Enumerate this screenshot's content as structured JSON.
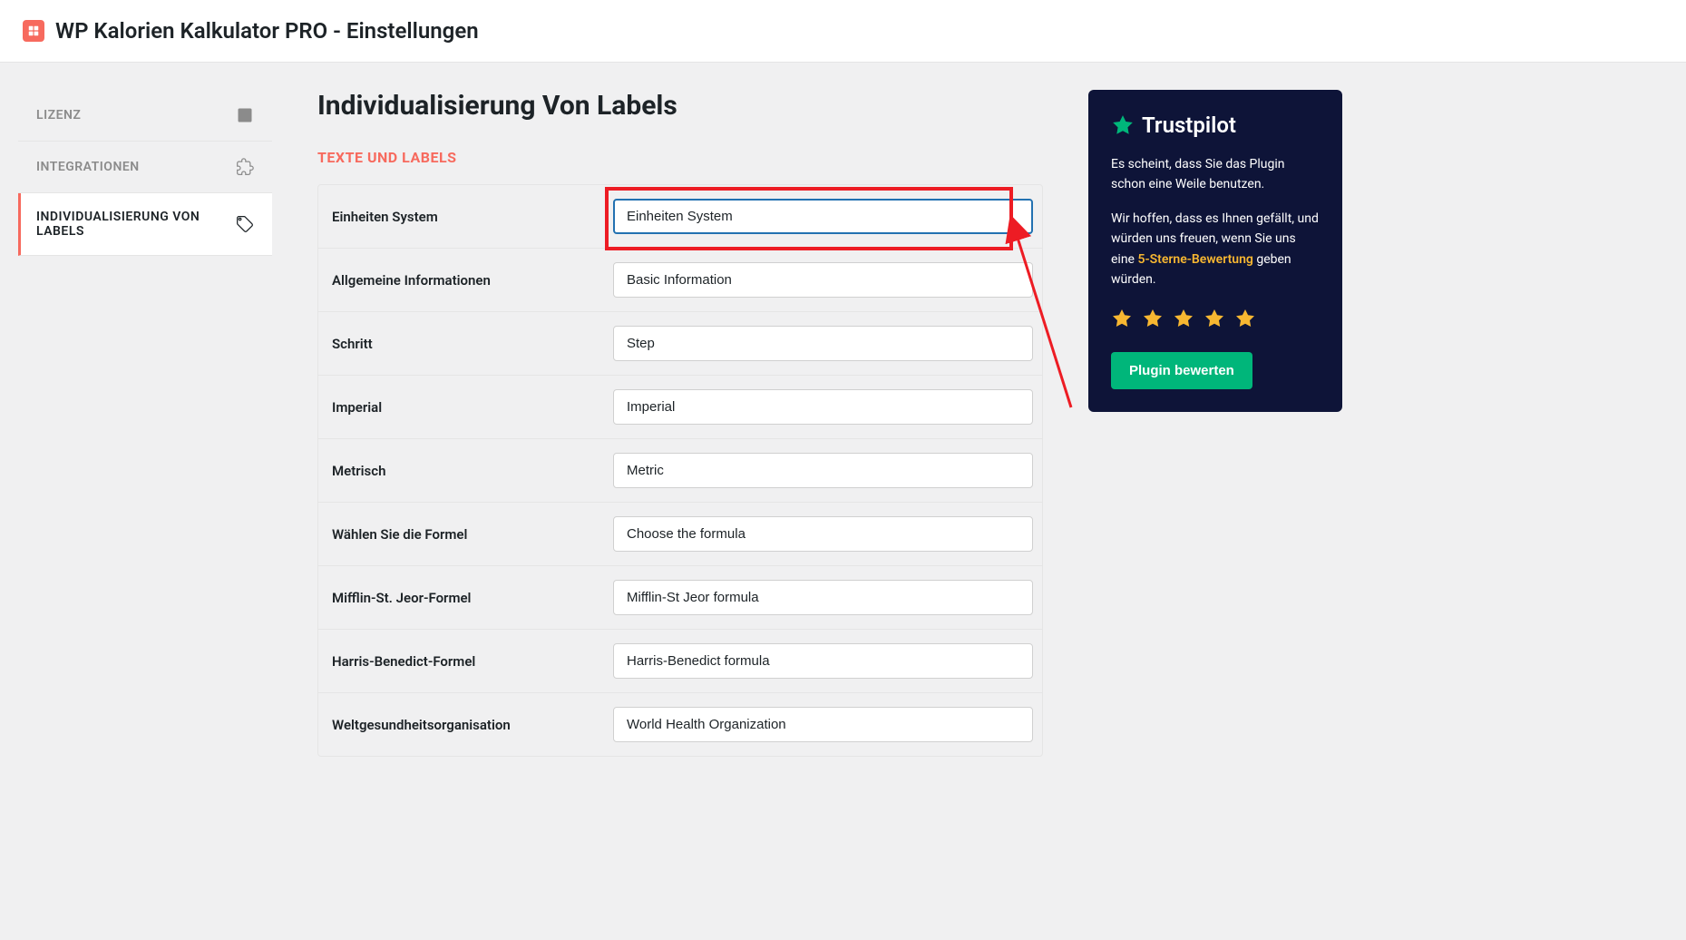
{
  "header": {
    "title": "WP Kalorien Kalkulator PRO - Einstellungen"
  },
  "sidebar": {
    "items": [
      {
        "label": "LIZENZ",
        "active": false,
        "icon": "license"
      },
      {
        "label": "INTEGRATIONEN",
        "active": false,
        "icon": "puzzle"
      },
      {
        "label": "INDIVIDUALISIERUNG VON LABELS",
        "active": true,
        "icon": "tag"
      }
    ]
  },
  "main": {
    "title": "Individualisierung Von Labels",
    "section_label": "TEXTE UND LABELS",
    "rows": [
      {
        "label": "Einheiten System",
        "value": "Einheiten System",
        "highlighted": true
      },
      {
        "label": "Allgemeine Informationen",
        "value": "Basic Information"
      },
      {
        "label": "Schritt",
        "value": "Step"
      },
      {
        "label": "Imperial",
        "value": "Imperial"
      },
      {
        "label": "Metrisch",
        "value": "Metric"
      },
      {
        "label": "Wählen Sie die Formel",
        "value": "Choose the formula"
      },
      {
        "label": "Mifflin-St. Jeor-Formel",
        "value": "Mifflin-St Jeor formula"
      },
      {
        "label": "Harris-Benedict-Formel",
        "value": "Harris-Benedict formula"
      },
      {
        "label": "Weltgesundheitsorganisation",
        "value": "World Health Organization"
      }
    ]
  },
  "trustpilot": {
    "brand": "Trustpilot",
    "message1": "Es scheint, dass Sie das Plugin schon eine Weile benutzen.",
    "message2_pre": "Wir hoffen, dass es Ihnen gefällt, und würden uns freuen, wenn Sie uns eine ",
    "message2_highlight": "5-Sterne-Bewertung",
    "message2_post": " geben würden.",
    "button_label": "Plugin bewerten"
  }
}
